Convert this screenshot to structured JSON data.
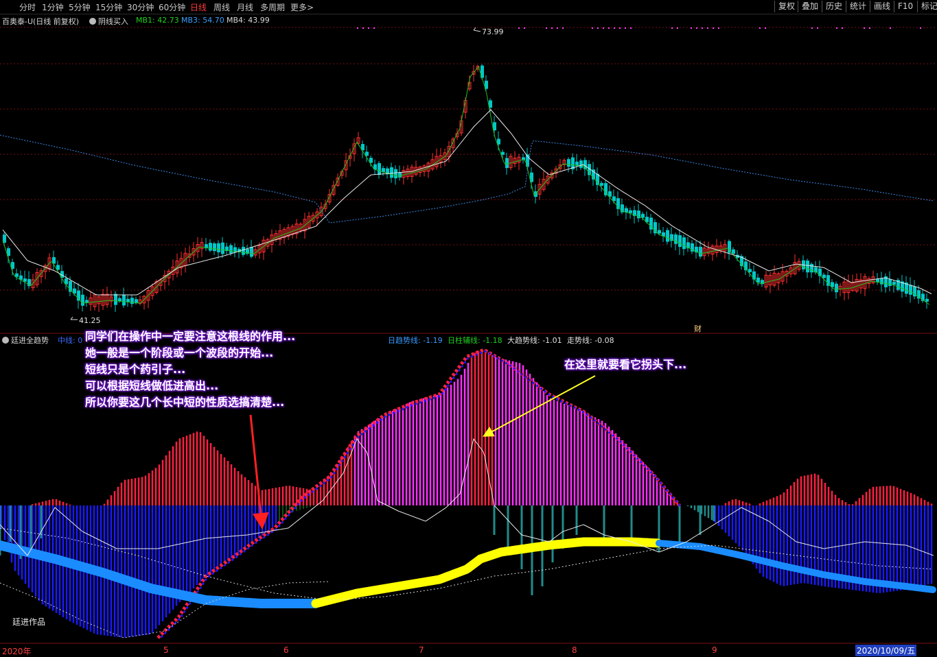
{
  "toolbar": {
    "timeframes": [
      "分时",
      "1分钟",
      "5分钟",
      "15分钟",
      "30分钟",
      "60分钟",
      "日线",
      "周线",
      "月线",
      "多周期",
      "更多"
    ],
    "more_arrow": ">",
    "right_buttons": [
      "复权",
      "叠加",
      "历史",
      "统计",
      "画线",
      "F10",
      "标记"
    ]
  },
  "main_chart": {
    "title": "百奥泰-U(日线 前复权)",
    "indicator_name": "阴线买入",
    "mb1": "MB1: 42.73",
    "mb3": "MB3: 54.70",
    "mb4": "MB4: 43.99",
    "high_label": "73.99",
    "low_label": "41.25",
    "cai_label": "财",
    "colors": {
      "up": "#ff3030",
      "down": "#00c8c8",
      "ma_short": "#20c020",
      "ma_long": "#e8e8e8",
      "ma_dotted": "#3a8be8"
    }
  },
  "sub_chart": {
    "title": "廷进全趋势",
    "zhongxian": "中线: 0",
    "ri_qushi": "日趋势线: -1.19",
    "ri_zhu": "日柱辅线: -1.18",
    "da_qushi": "大趋势线: -1.01",
    "zou_shi": "走势线: -0.08",
    "watermark": "廷进作品",
    "colors": {
      "red": "#ff2040",
      "magenta": "#ff30ff",
      "blue": "#1a1aff",
      "teal": "#1f8c8c",
      "green": "#2aa02a",
      "yellow": "#ffff00",
      "lightblue": "#1a8cff"
    }
  },
  "annotations": {
    "left_lines": [
      "同学们在操作中一定要注意这根线的作用...",
      "她一般是一个阶段或一个波段的开始...",
      "短线只是个药引子...",
      "可以根据短线做低进高出...",
      "所以你要这几个长中短的性质选搞清楚..."
    ],
    "right_line": "在这里就要看它拐头下..."
  },
  "time_axis": {
    "labels": [
      "2020年",
      "5",
      "6",
      "7",
      "8",
      "9"
    ],
    "current_date": "2020/10/09/五"
  }
}
